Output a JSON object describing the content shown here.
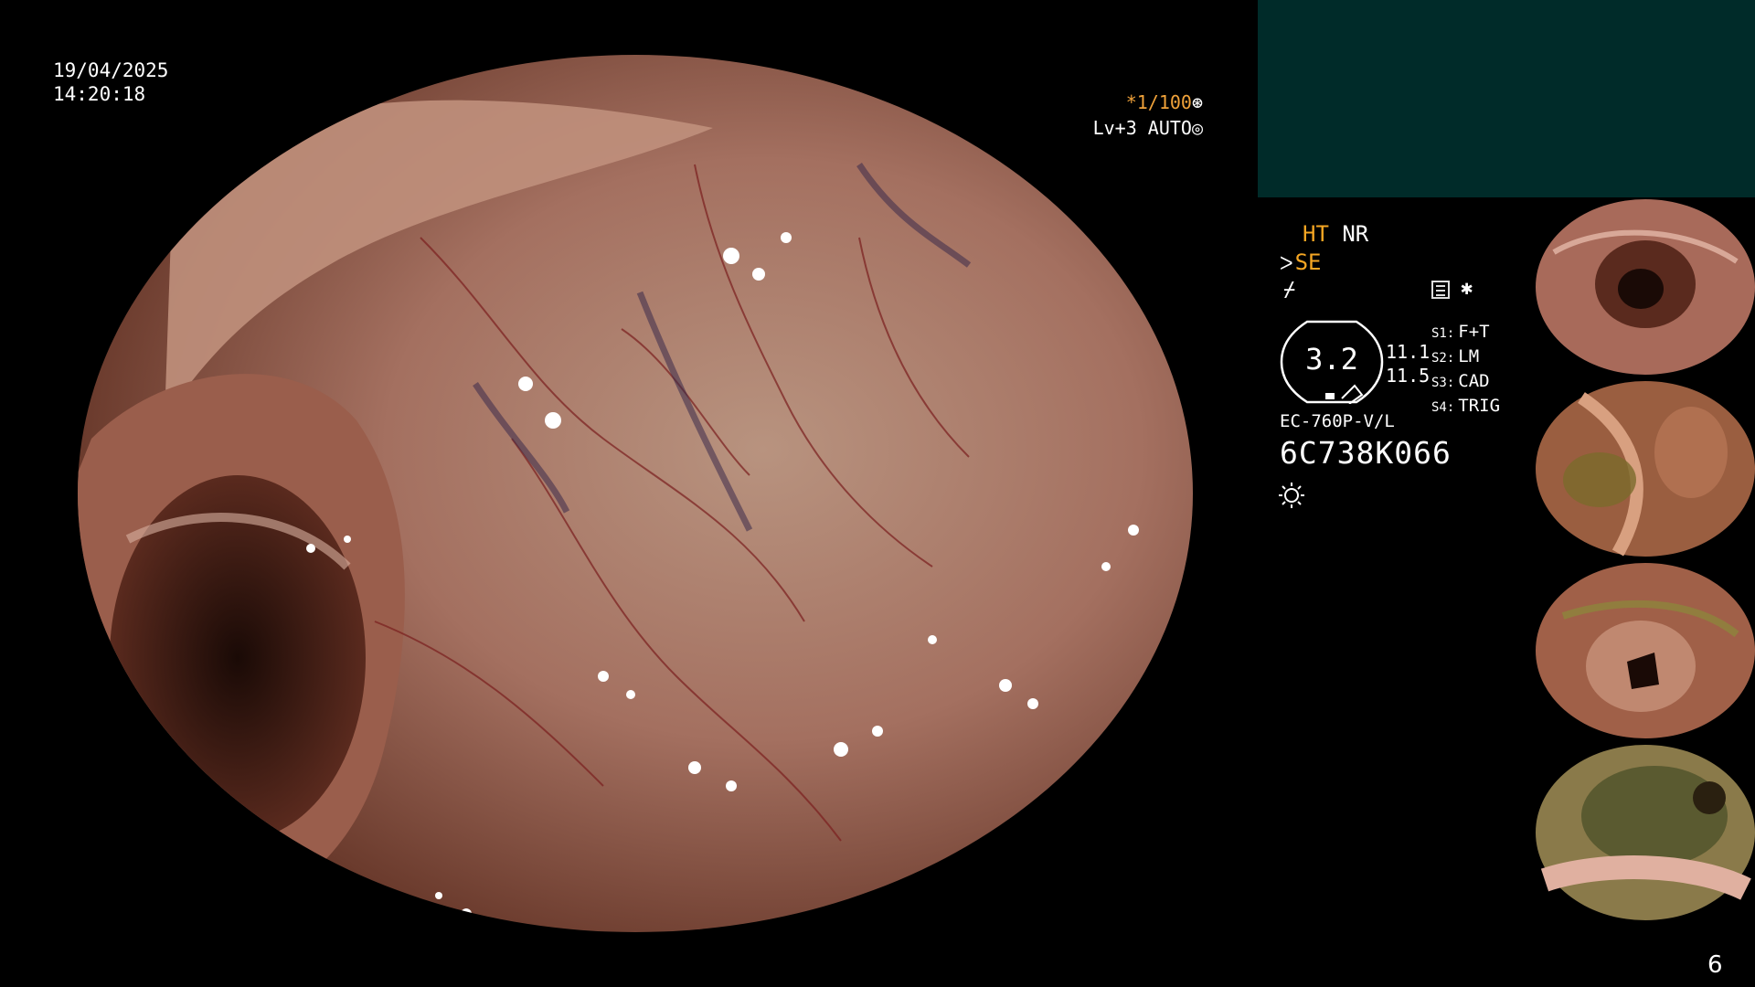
{
  "overlay": {
    "date": "19/04/2025",
    "time": "14:20:18",
    "shutter": "*1/100",
    "level": "Lv+3 AUTO"
  },
  "panel": {
    "ht": "HT",
    "nr": "NR",
    "se": "SE",
    "gauge_value": "3.2",
    "values": [
      "11.1",
      "11.5"
    ],
    "switches": [
      {
        "key": "S1:",
        "value": "F+T"
      },
      {
        "key": "S2:",
        "value": "LM"
      },
      {
        "key": "S3:",
        "value": "CAD"
      },
      {
        "key": "S4:",
        "value": "TRIG"
      }
    ],
    "model": "EC-760P-V/L",
    "serial": "6C738K066"
  },
  "thumbnails": [
    {
      "label": "thumbnail-1",
      "tone": "#a86a5a"
    },
    {
      "label": "thumbnail-2",
      "tone": "#8a5a3a"
    },
    {
      "label": "thumbnail-3",
      "tone": "#9a6048"
    },
    {
      "label": "thumbnail-4",
      "tone": "#7a6a4a"
    }
  ],
  "page_number": "6",
  "colors": {
    "accent_orange": "#f5a623",
    "panel_teal": "#002b29",
    "mucosa": "#b07a62"
  }
}
